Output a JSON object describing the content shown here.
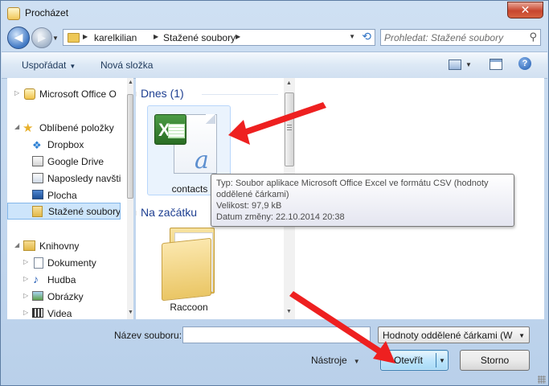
{
  "window": {
    "title": "Procházet",
    "close_glyph": "✕"
  },
  "navigation": {
    "back_glyph": "◀",
    "forward_glyph": "▶",
    "breadcrumb": [
      "karelkilian",
      "Stažené soubory"
    ],
    "search_placeholder": "Prohledat: Stažené soubory"
  },
  "toolbar": {
    "organize_label": "Uspořádat",
    "new_folder_label": "Nová složka",
    "help_glyph": "?"
  },
  "sidebar": {
    "items": [
      {
        "label": "Microsoft Office O",
        "icon": "outlook-icon"
      },
      {
        "label": "Oblíbené položky",
        "icon": "star-icon"
      },
      {
        "label": "Dropbox",
        "icon": "dropbox-icon"
      },
      {
        "label": "Google Drive",
        "icon": "google-drive-icon"
      },
      {
        "label": "Naposledy navšti",
        "icon": "recent-places-icon"
      },
      {
        "label": "Plocha",
        "icon": "desktop-icon"
      },
      {
        "label": "Stažené soubory",
        "icon": "downloads-folder-icon",
        "selected": true
      },
      {
        "label": "Knihovny",
        "icon": "libraries-icon"
      },
      {
        "label": "Dokumenty",
        "icon": "documents-icon"
      },
      {
        "label": "Hudba",
        "icon": "music-icon"
      },
      {
        "label": "Obrázky",
        "icon": "pictures-icon"
      },
      {
        "label": "Videa",
        "icon": "videos-icon"
      }
    ]
  },
  "files": {
    "groups": [
      {
        "title": "Dnes (1)"
      },
      {
        "title": "Na začátku"
      }
    ],
    "items": [
      {
        "name": "contacts",
        "icon": "excel-csv-file-icon"
      },
      {
        "name": "Raccoon",
        "icon": "folder-icon"
      }
    ]
  },
  "tooltip": {
    "type_line": "Typ: Soubor aplikace Microsoft Office Excel ve formátu CSV (hodnoty",
    "type_line2": "oddělené čárkami)",
    "size_line": "Velikost: 97,9 kB",
    "date_line": "Datum změny: 22.10.2014 20:38"
  },
  "bottom": {
    "filename_label": "Název souboru:",
    "filename_value": "",
    "filetype_selected": "Hodnoty oddělené čárkami (Wi",
    "tools_label": "Nástroje",
    "open_label": "Otevřít",
    "cancel_label": "Storno"
  },
  "colors": {
    "annotation_arrow": "#ee2020",
    "group_header": "#1e3f91",
    "selection": "#cde5fb"
  }
}
